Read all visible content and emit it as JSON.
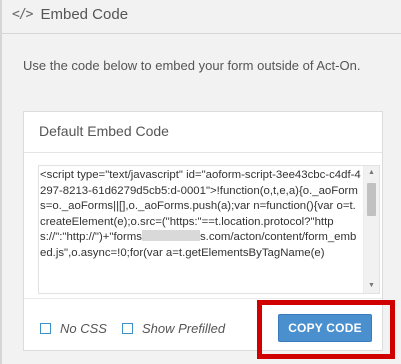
{
  "header": {
    "icon": "code-icon",
    "icon_glyph": "</>",
    "title": "Embed Code"
  },
  "description": "Use the code below to embed your form outside of Act-On.",
  "card": {
    "title": "Default Embed Code",
    "code_before_redaction": "<script type=\"text/javascript\" id=\"aoform-script-3ee43cbc-c4df-4297-8213-61d6279d5cb5:d-0001\">!function(o,t,e,a){o._aoForms=o._aoForms||[],o._aoForms.push(a);var n=function(){var o=t.createElement(e);o.src=(\"https:\"==t.location.protocol?\"https://\":\"http://\")+\"forms",
    "code_after_redaction": "s.com/acton/content/form_embed.js\",o.async=!0;for(var a=t.getElementsByTagName(e)"
  },
  "options": {
    "no_css_label": "No CSS",
    "no_css_checked": false,
    "show_prefilled_label": "Show Prefilled",
    "show_prefilled_checked": false
  },
  "copy_button_label": "COPY CODE",
  "colors": {
    "primary_button": "#4a8fce",
    "highlight_border": "#d10000",
    "checkbox_border": "#3d8fc6"
  }
}
